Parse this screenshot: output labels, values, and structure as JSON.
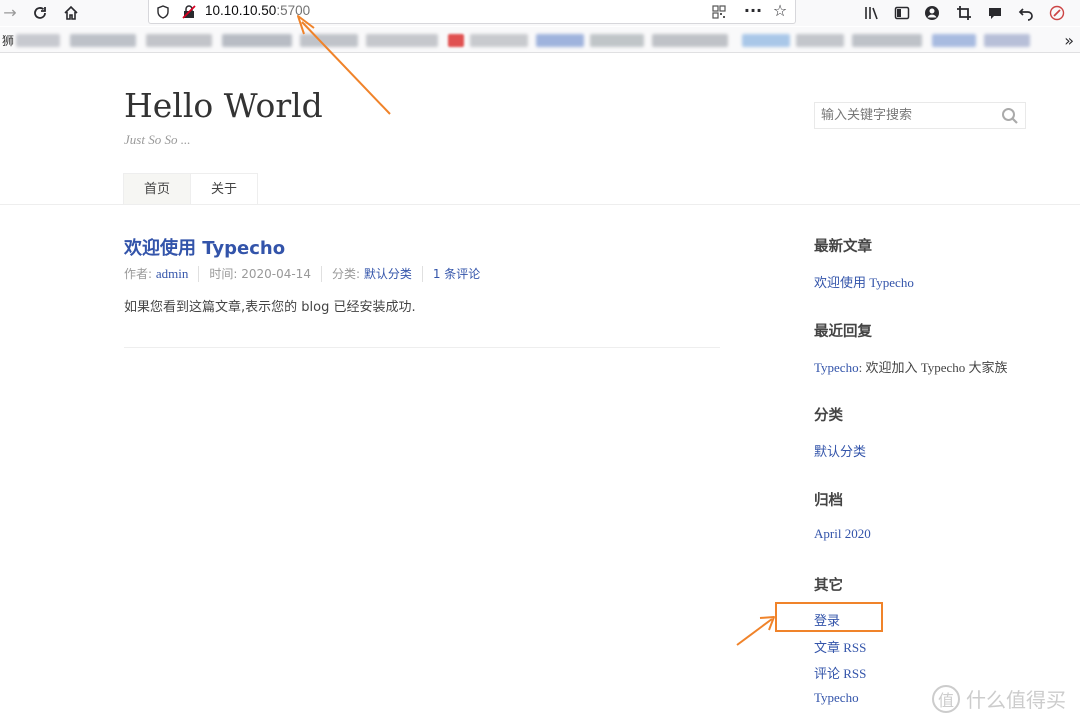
{
  "browser": {
    "url_host": "10.10.10.50",
    "url_port": ":5700",
    "bookmarks_first": "狮",
    "icons": [
      "back-arrow-icon",
      "reload-icon",
      "home-icon",
      "shield-icon",
      "insecure-lock-icon",
      "qr-code-icon",
      "more-icon",
      "star-icon",
      "library-icon",
      "sidebar-icon",
      "account-icon",
      "crop-icon",
      "chat-icon",
      "undo-icon",
      "addon-icon",
      "chevron-overflow-icon"
    ]
  },
  "site": {
    "title": "Hello World",
    "description": "Just So So ...",
    "search_placeholder": "输入关键字搜索"
  },
  "nav": {
    "items": [
      {
        "label": "首页"
      },
      {
        "label": "关于"
      }
    ]
  },
  "post": {
    "title": "欢迎使用 Typecho",
    "author_label": "作者: ",
    "author": "admin",
    "date": "时间: 2020-04-14",
    "category_label": "分类: ",
    "category": "默认分类",
    "comments": "1 条评论",
    "content": "如果您看到这篇文章,表示您的 blog 已经安装成功."
  },
  "sidebar": {
    "recent_posts_title": "最新文章",
    "recent_posts": [
      "欢迎使用 Typecho"
    ],
    "recent_comments_title": "最近回复",
    "recent_comment_author": "Typecho",
    "recent_comment_text": ": 欢迎加入 Typecho 大家族",
    "categories_title": "分类",
    "categories": [
      "默认分类"
    ],
    "archives_title": "归档",
    "archives": [
      "April 2020"
    ],
    "misc_title": "其它",
    "misc": [
      "登录",
      "文章 RSS",
      "评论 RSS",
      "Typecho"
    ]
  },
  "watermark": {
    "logo": "值",
    "text": "什么值得买"
  },
  "colors": {
    "link": "#3354aa",
    "annotation": "#f0832a"
  }
}
